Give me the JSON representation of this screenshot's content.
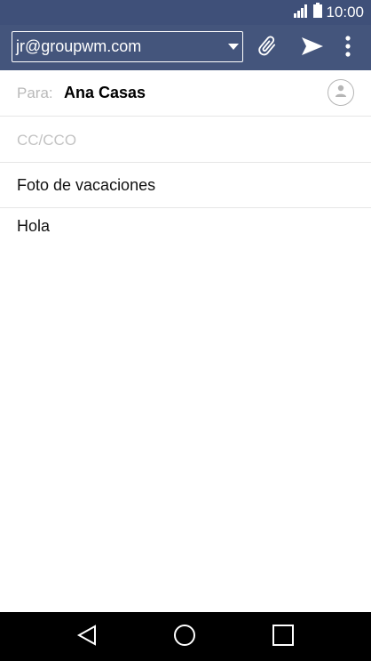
{
  "status_bar": {
    "time": "10:00",
    "icons": [
      "signal-icon",
      "battery-icon"
    ]
  },
  "toolbar": {
    "account_value": "jr@groupwm.com",
    "icons": [
      "dropdown-caret-icon",
      "attach-icon",
      "send-icon",
      "more-vert-icon"
    ]
  },
  "compose": {
    "to_label": "Para:",
    "to_value": "Ana Casas",
    "cc_placeholder": "CC/CCO",
    "subject": "Foto de vacaciones",
    "body": "Hola"
  },
  "nav_bar": {
    "icons": [
      "back-icon",
      "home-icon",
      "recents-icon"
    ]
  },
  "colors": {
    "status_bar_bg": "#3f5079",
    "app_bar_bg": "#44557c",
    "nav_bar_bg": "#000000"
  }
}
